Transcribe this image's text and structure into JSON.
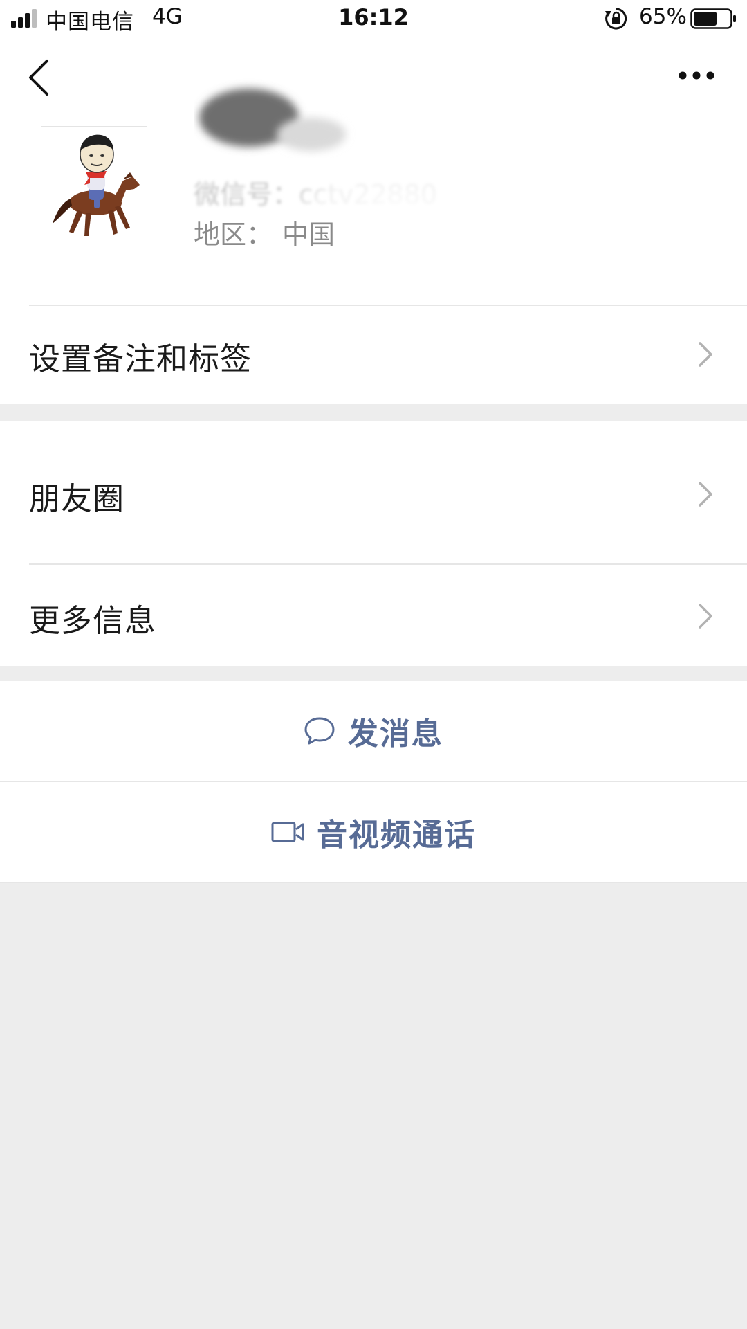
{
  "status_bar": {
    "carrier": "中国电信",
    "network": "4G",
    "time": "16:12",
    "battery_percent": "65%",
    "battery_level": 0.65
  },
  "profile": {
    "wechat_id_label": "微信号：",
    "wechat_id_value": "cctv22880",
    "region_label": "地区：",
    "region_value": "中国"
  },
  "rows": {
    "remark_tags": "设置备注和标签",
    "moments": "朋友圈",
    "more_info": "更多信息"
  },
  "actions": {
    "send_message": "发消息",
    "av_call": "音视频通话"
  },
  "colors": {
    "link_blue": "#576b95",
    "page_background": "#ededed",
    "card_background": "#ffffff"
  },
  "icons": {
    "back": "chevron-left-icon",
    "more": "ellipsis-icon",
    "chevron": "chevron-right-icon",
    "message": "chat-bubble-icon",
    "video": "video-camera-icon"
  }
}
